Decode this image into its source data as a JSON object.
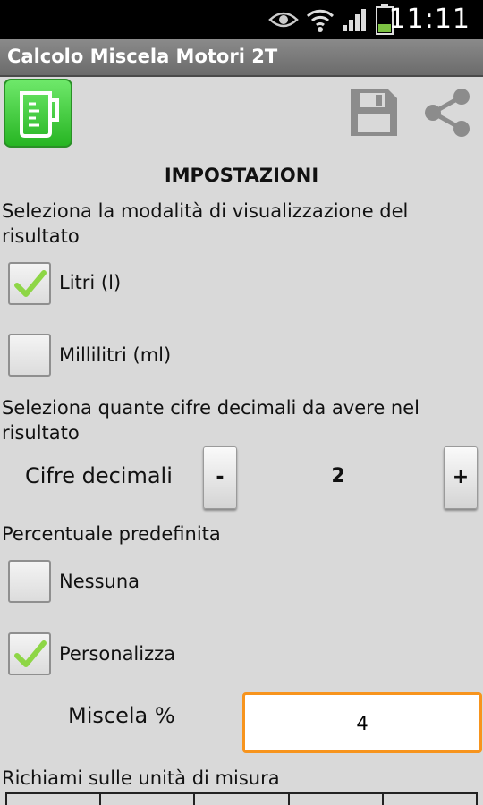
{
  "status_bar": {
    "time": "11:11"
  },
  "app": {
    "title": "Calcolo Miscela Motori 2T"
  },
  "heading": "IMPOSTAZIONI",
  "display_mode": {
    "prompt": "Seleziona la modalità di visualizzazione del risultato",
    "options": [
      {
        "label": "Litri (l)",
        "checked": true
      },
      {
        "label": "Millilitri (ml)",
        "checked": false
      }
    ]
  },
  "decimals": {
    "prompt": "Seleziona quante cifre decimali da avere nel risultato",
    "label": "Cifre decimali",
    "minus": "-",
    "value": "2",
    "plus": "+"
  },
  "default_percentage": {
    "prompt": "Percentuale predefinita",
    "options": [
      {
        "label": "Nessuna",
        "checked": false
      },
      {
        "label": "Personalizza",
        "checked": true
      }
    ],
    "mix_label": "Miscela %",
    "mix_value": "4"
  },
  "units_section": {
    "title": "Richiami sulle unità di misura"
  },
  "colors": {
    "accent": "#f7941d",
    "check": "#8ed646",
    "logo": "#3fcf3a"
  }
}
